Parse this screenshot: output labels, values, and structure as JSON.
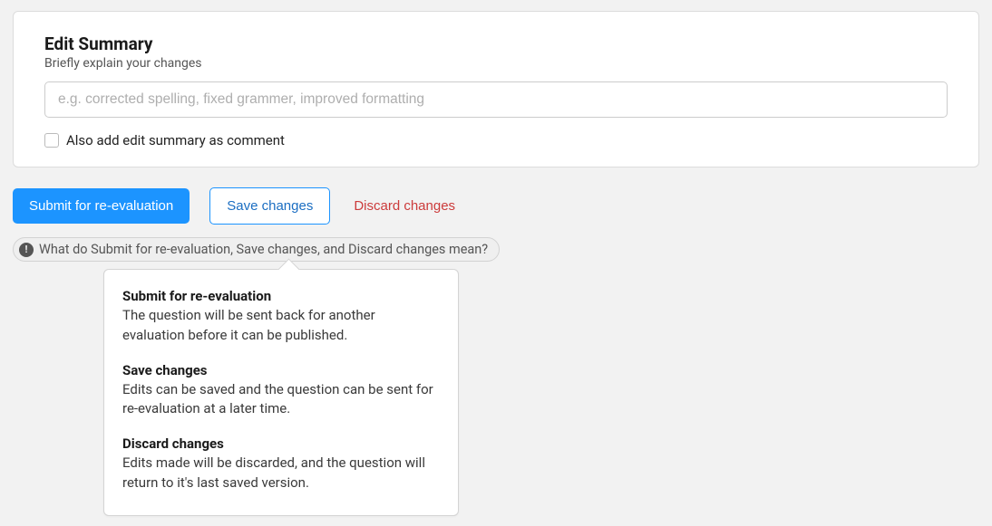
{
  "summaryCard": {
    "title": "Edit Summary",
    "subtitle": "Briefly explain your changes",
    "placeholder": "e.g. corrected spelling, fixed grammer, improved formatting",
    "checkboxLabel": "Also add edit summary as comment"
  },
  "buttons": {
    "submit": "Submit for re-evaluation",
    "save": "Save changes",
    "discard": "Discard changes"
  },
  "helpPill": {
    "iconGlyph": "!",
    "text": "What do Submit for re-evaluation, Save changes, and Discard changes mean?"
  },
  "tooltip": {
    "sections": [
      {
        "title": "Submit for re-evaluation",
        "body": "The question will be sent back for another evaluation before it can be published."
      },
      {
        "title": "Save changes",
        "body": "Edits can be saved and the question can be sent for re-evaluation at a later time."
      },
      {
        "title": "Discard changes",
        "body": "Edits made will be discarded, and the question will return to it's last saved version."
      }
    ]
  }
}
